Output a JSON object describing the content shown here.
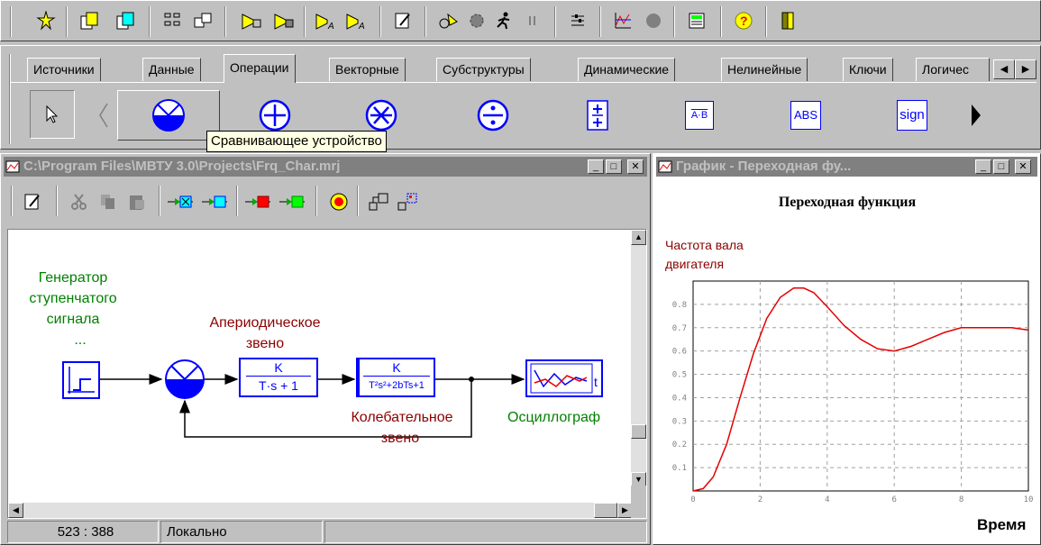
{
  "tabs": [
    "Источники",
    "Данные",
    "Операции",
    "Векторные",
    "Субструктуры",
    "Динамические",
    "Нелинейные",
    "Ключи",
    "Логичес"
  ],
  "tooltip": "Сравнивающее устройство",
  "palette": {
    "abs": "ABS",
    "sign": "sign",
    "ab": "A·B"
  },
  "project_window": {
    "title": "C:\\Program Files\\МВТУ 3.0\\Projects\\Frq_Char.mrj"
  },
  "diagram": {
    "gen_label_1": "Генератор",
    "gen_label_2": "ступенчатого",
    "gen_label_3": "сигнала",
    "gen_label_4": "...",
    "aper_label_1": "Апериодическое",
    "aper_label_2": "звено",
    "osc_label_1": "Колебательное",
    "osc_label_2": "звено",
    "scope_label": "Осциллограф",
    "aper_num": "K",
    "aper_den": "T·s + 1",
    "osc_num": "K",
    "osc_den": "T²s²+2bTs+1"
  },
  "status": {
    "coords": "523 : 388",
    "mode": "Локально"
  },
  "graph_window": {
    "title": "График - Переходная фу..."
  },
  "chart_data": {
    "type": "line",
    "title": "Переходная функция",
    "ylabel_1": "Частота вала",
    "ylabel_2": "двигателя",
    "xlabel": "Время",
    "xlim": [
      0,
      10
    ],
    "ylim": [
      0,
      0.9
    ],
    "x_ticks": [
      "0",
      "2",
      "4",
      "6",
      "8",
      "10"
    ],
    "y_ticks": [
      "0.1",
      "0.2",
      "0.3",
      "0.4",
      "0.5",
      "0.6",
      "0.7",
      "0.8"
    ],
    "grid": true,
    "series": [
      {
        "color": "#e60000",
        "x": [
          0,
          0.3,
          0.6,
          1.0,
          1.4,
          1.8,
          2.2,
          2.6,
          3.0,
          3.3,
          3.6,
          4.0,
          4.5,
          5.0,
          5.5,
          6.0,
          6.5,
          7.0,
          7.5,
          8.0,
          8.5,
          9.0,
          9.5,
          10.0
        ],
        "y": [
          0,
          0.01,
          0.06,
          0.2,
          0.4,
          0.59,
          0.74,
          0.83,
          0.87,
          0.87,
          0.85,
          0.79,
          0.71,
          0.65,
          0.61,
          0.6,
          0.62,
          0.65,
          0.68,
          0.7,
          0.7,
          0.7,
          0.7,
          0.69
        ]
      }
    ]
  },
  "colors": {
    "accent_blue": "#0000ff",
    "dark_red": "#8b0000",
    "green": "#008000",
    "curve": "#e60000"
  }
}
